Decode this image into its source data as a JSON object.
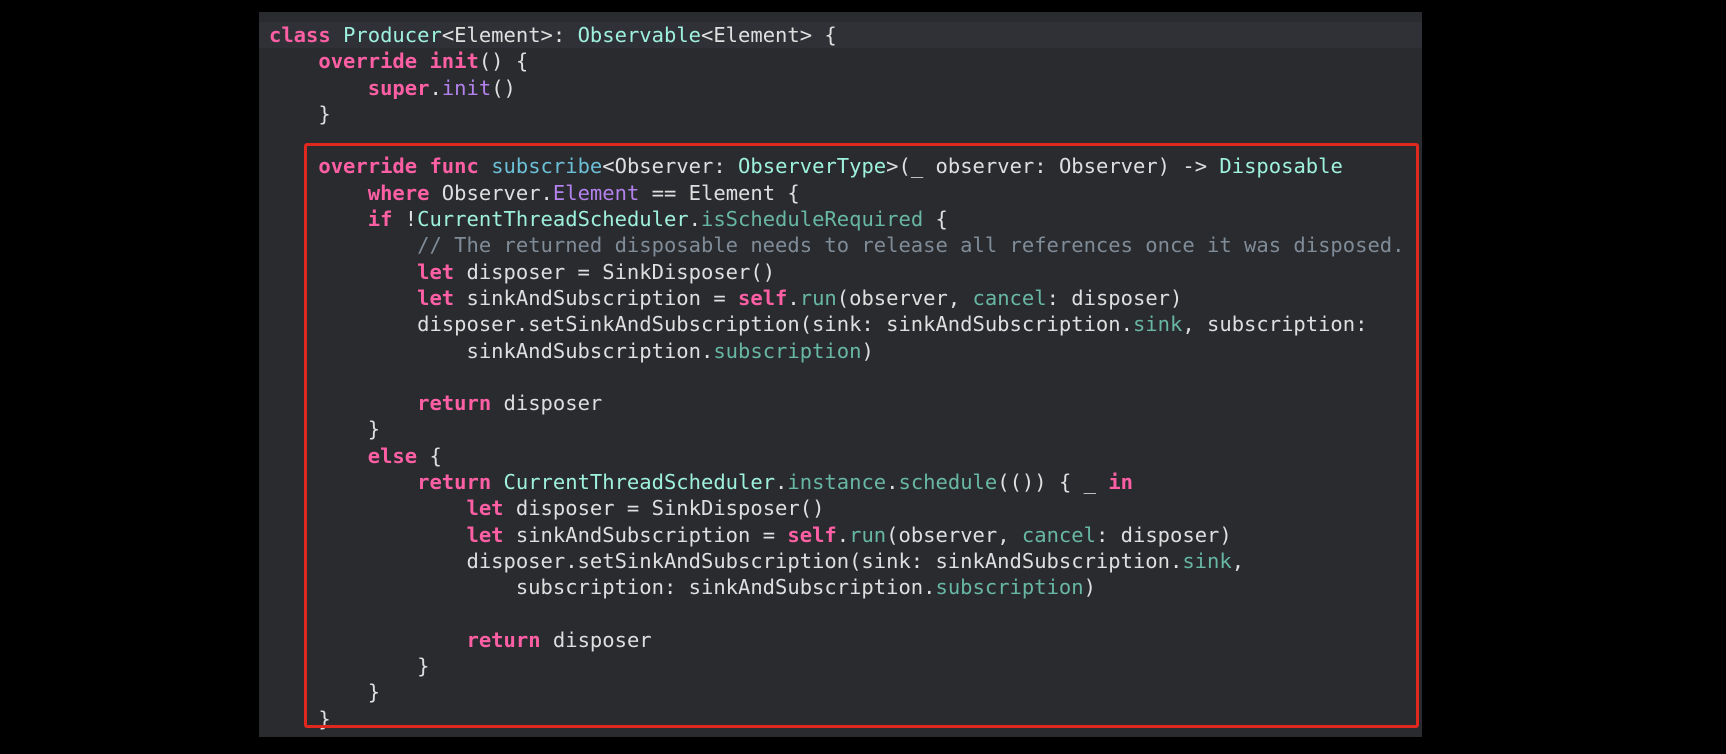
{
  "colors": {
    "background": "#000000",
    "editor_background": "#2a2b2f",
    "keyword": "#fc5fa3",
    "type": "#9ef1dd",
    "function_decl": "#6bbfd7",
    "identifier": "#67b7a4",
    "comment": "#7f8c98",
    "plain": "#dfdfe0",
    "highlight_border": "#e0281e"
  },
  "code_lines": [
    [
      [
        "kw",
        "class"
      ],
      [
        "tx",
        " "
      ],
      [
        "ty",
        "Producer"
      ],
      [
        "tx",
        "<Element>: "
      ],
      [
        "ty",
        "Observable"
      ],
      [
        "tx",
        "<Element> {"
      ]
    ],
    [
      [
        "tx",
        "    "
      ],
      [
        "kw",
        "override"
      ],
      [
        "tx",
        " "
      ],
      [
        "kw",
        "init"
      ],
      [
        "tx",
        "() {"
      ]
    ],
    [
      [
        "tx",
        "        "
      ],
      [
        "kw",
        "super"
      ],
      [
        "tx",
        "."
      ],
      [
        "sv",
        "init"
      ],
      [
        "tx",
        "()"
      ]
    ],
    [
      [
        "tx",
        "    }"
      ]
    ],
    [
      [
        "tx",
        ""
      ]
    ],
    [
      [
        "tx",
        "    "
      ],
      [
        "kw",
        "override"
      ],
      [
        "tx",
        " "
      ],
      [
        "kw",
        "func"
      ],
      [
        "tx",
        " "
      ],
      [
        "fn",
        "subscribe"
      ],
      [
        "tx",
        "<Observer: "
      ],
      [
        "ty",
        "ObserverType"
      ],
      [
        "tx",
        ">(_ observer: Observer) -> "
      ],
      [
        "ty",
        "Disposable"
      ]
    ],
    [
      [
        "tx",
        "        "
      ],
      [
        "kw",
        "where"
      ],
      [
        "tx",
        " Observer."
      ],
      [
        "sv",
        "Element"
      ],
      [
        "tx",
        " == Element {"
      ]
    ],
    [
      [
        "tx",
        "        "
      ],
      [
        "kw",
        "if"
      ],
      [
        "tx",
        " !"
      ],
      [
        "ty",
        "CurrentThreadScheduler"
      ],
      [
        "tx",
        "."
      ],
      [
        "id",
        "isScheduleRequired"
      ],
      [
        "tx",
        " {"
      ]
    ],
    [
      [
        "tx",
        "            "
      ],
      [
        "cm",
        "// The returned disposable needs to release all references once it was disposed."
      ]
    ],
    [
      [
        "tx",
        "            "
      ],
      [
        "kw",
        "let"
      ],
      [
        "tx",
        " disposer = SinkDisposer()"
      ]
    ],
    [
      [
        "tx",
        "            "
      ],
      [
        "kw",
        "let"
      ],
      [
        "tx",
        " sinkAndSubscription = "
      ],
      [
        "kw",
        "self"
      ],
      [
        "tx",
        "."
      ],
      [
        "id",
        "run"
      ],
      [
        "tx",
        "(observer, "
      ],
      [
        "id",
        "cancel"
      ],
      [
        "tx",
        ": disposer)"
      ]
    ],
    [
      [
        "tx",
        "            disposer.setSinkAndSubscription(sink: sinkAndSubscription."
      ],
      [
        "id",
        "sink"
      ],
      [
        "tx",
        ", subscription:"
      ]
    ],
    [
      [
        "tx",
        "                sinkAndSubscription."
      ],
      [
        "id",
        "subscription"
      ],
      [
        "tx",
        ")"
      ]
    ],
    [
      [
        "tx",
        ""
      ]
    ],
    [
      [
        "tx",
        "            "
      ],
      [
        "kw",
        "return"
      ],
      [
        "tx",
        " disposer"
      ]
    ],
    [
      [
        "tx",
        "        }"
      ]
    ],
    [
      [
        "tx",
        "        "
      ],
      [
        "kw",
        "else"
      ],
      [
        "tx",
        " {"
      ]
    ],
    [
      [
        "tx",
        "            "
      ],
      [
        "kw",
        "return"
      ],
      [
        "tx",
        " "
      ],
      [
        "ty",
        "CurrentThreadScheduler"
      ],
      [
        "tx",
        "."
      ],
      [
        "id",
        "instance"
      ],
      [
        "tx",
        "."
      ],
      [
        "id",
        "schedule"
      ],
      [
        "tx",
        "(()) { _ "
      ],
      [
        "kw",
        "in"
      ]
    ],
    [
      [
        "tx",
        "                "
      ],
      [
        "kw",
        "let"
      ],
      [
        "tx",
        " disposer = SinkDisposer()"
      ]
    ],
    [
      [
        "tx",
        "                "
      ],
      [
        "kw",
        "let"
      ],
      [
        "tx",
        " sinkAndSubscription = "
      ],
      [
        "kw",
        "self"
      ],
      [
        "tx",
        "."
      ],
      [
        "id",
        "run"
      ],
      [
        "tx",
        "(observer, "
      ],
      [
        "id",
        "cancel"
      ],
      [
        "tx",
        ": disposer)"
      ]
    ],
    [
      [
        "tx",
        "                disposer.setSinkAndSubscription(sink: sinkAndSubscription."
      ],
      [
        "id",
        "sink"
      ],
      [
        "tx",
        ","
      ]
    ],
    [
      [
        "tx",
        "                    subscription: sinkAndSubscription."
      ],
      [
        "id",
        "subscription"
      ],
      [
        "tx",
        ")"
      ]
    ],
    [
      [
        "tx",
        ""
      ]
    ],
    [
      [
        "tx",
        "                "
      ],
      [
        "kw",
        "return"
      ],
      [
        "tx",
        " disposer"
      ]
    ],
    [
      [
        "tx",
        "            }"
      ]
    ],
    [
      [
        "tx",
        "        }"
      ]
    ],
    [
      [
        "tx",
        "    }"
      ]
    ]
  ]
}
